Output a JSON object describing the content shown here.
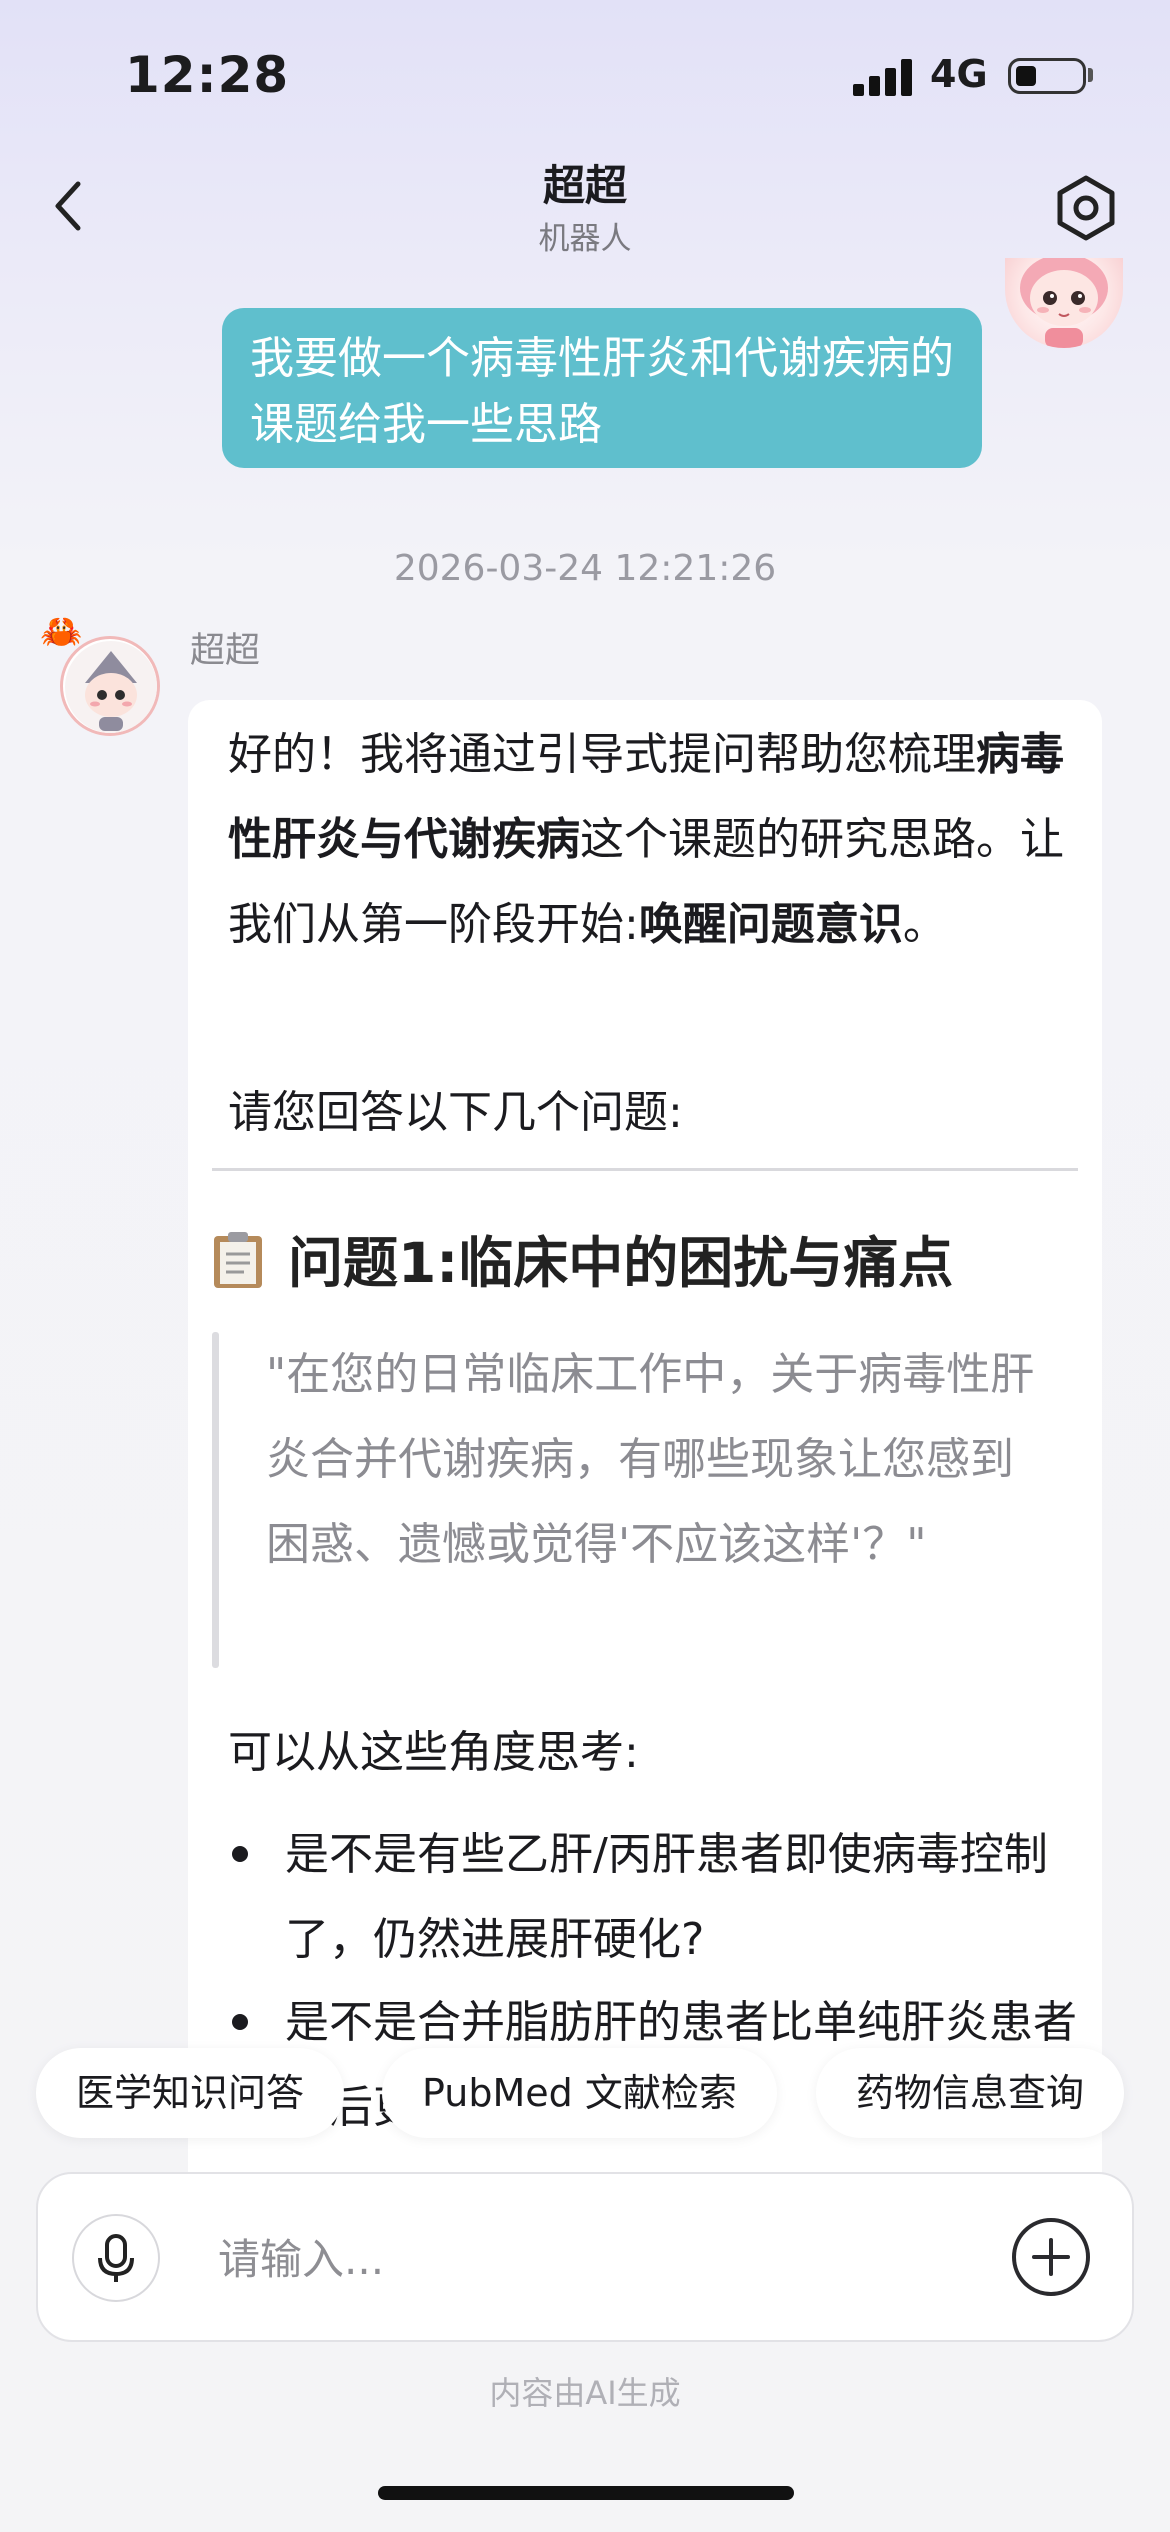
{
  "status_bar": {
    "time": "12:28",
    "network": "4G"
  },
  "nav": {
    "title": "超超",
    "subtitle": "机器人"
  },
  "user_message": {
    "text": "我要做一个病毒性肝炎和代谢疾病的课题给我一些思路"
  },
  "timestamp": "2026-03-24 12:21:26",
  "bot": {
    "name": "超超",
    "intro_1": "好的！我将通过引导式提问帮助您梳理",
    "intro_bold_1": "病毒性肝炎与代谢疾病",
    "intro_2": "这个课题的研究思路。让我们从第一阶段开始:",
    "intro_bold_2": "唤醒问题意识",
    "intro_3": "。",
    "ask": "请您回答以下几个问题:",
    "heading": "问题1:临床中的困扰与痛点",
    "quote": "\"在您的日常临床工作中，关于病毒性肝炎合并代谢疾病，有哪些现象让您感到困惑、遗憾或觉得'不应该这样'？\"",
    "think_label": "可以从这些角度思考:",
    "bullets": [
      "是不是有些乙肝/丙肝患者即使病毒控制了，仍然进展肝硬化?",
      "是不是合并脂肪肝的患者比单纯肝炎患者预后更差?其机制是什么?"
    ]
  },
  "chips": [
    "医学知识问答",
    "PubMed 文献检索",
    "药物信息查询"
  ],
  "input": {
    "placeholder": "请输入..."
  },
  "disclaimer": "内容由AI生成",
  "colors": {
    "user_bubble": "#5fbfcd",
    "page_bg": "#f4f4f6"
  }
}
